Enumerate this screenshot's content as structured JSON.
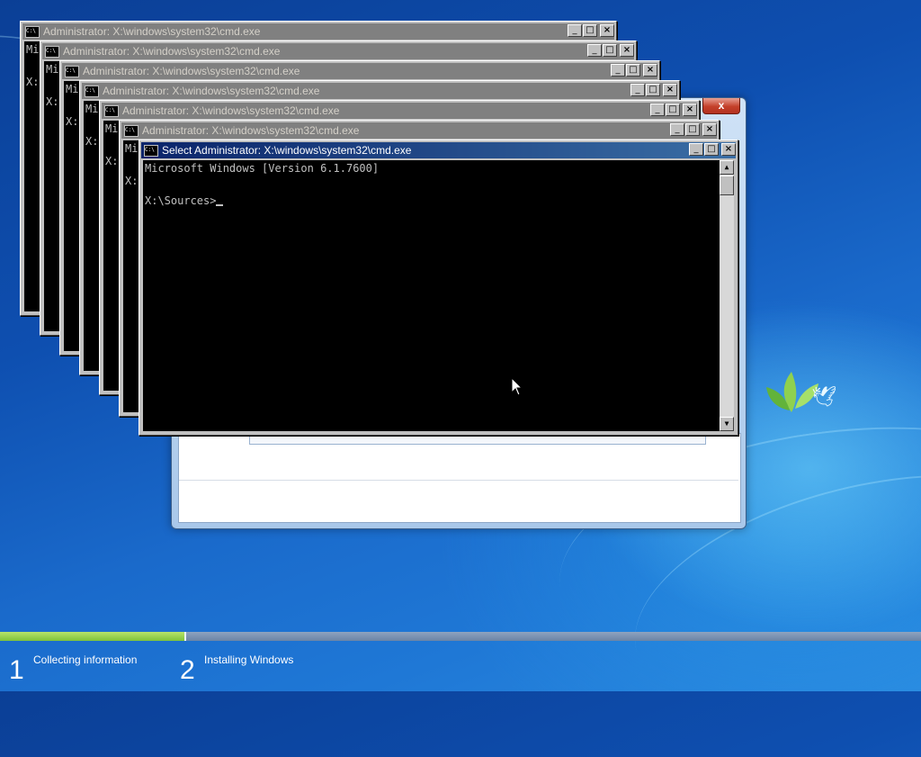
{
  "colors": {
    "progress_fill": "#7fc23a",
    "progress_track": "#7a90b1",
    "active_title": "#0a246a",
    "inactive_title": "#808080"
  },
  "background_windows": [
    {
      "title": "Administrator: X:\\windows\\system32\\cmd.exe",
      "lines": [
        "Mi",
        "",
        "X:"
      ]
    },
    {
      "title": "Administrator: X:\\windows\\system32\\cmd.exe",
      "lines": [
        "Mi",
        "",
        "X:"
      ]
    },
    {
      "title": "Administrator: X:\\windows\\system32\\cmd.exe",
      "lines": [
        "Mi",
        "",
        "X:"
      ]
    },
    {
      "title": "Administrator: X:\\windows\\system32\\cmd.exe",
      "lines": [
        "Mi",
        "",
        "X:"
      ]
    },
    {
      "title": "Administrator: X:\\windows\\system32\\cmd.exe",
      "lines": [
        "Mi",
        "",
        "X:"
      ]
    },
    {
      "title": "Administrator: X:\\windows\\system32\\cmd.exe",
      "lines": [
        "Mi",
        "",
        "X:"
      ]
    }
  ],
  "active_window": {
    "title": "Select Administrator: X:\\windows\\system32\\cmd.exe",
    "lines": [
      "Microsoft Windows [Version 6.1.7600]",
      "",
      "X:\\Sources>"
    ]
  },
  "window_buttons": {
    "minimize": "_",
    "maximize": "□",
    "close": "×"
  },
  "setup_dialog": {
    "close_glyph": "x"
  },
  "progress": {
    "completed_fraction": 0.2,
    "steps": [
      {
        "number": "1",
        "label": "Collecting information"
      },
      {
        "number": "2",
        "label": "Installing Windows"
      }
    ]
  }
}
